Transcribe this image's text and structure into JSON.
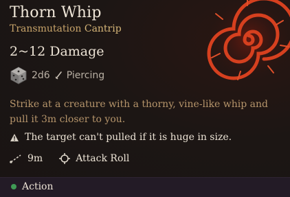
{
  "spell": {
    "name": "Thorn Whip",
    "school": "Transmutation",
    "level": "Cantrip",
    "damage": "2~12 Damage",
    "dice": "2d6",
    "damage_type": "Piercing",
    "description": "Strike at a creature with a thorny, vine-like whip and pull it 3m closer to you.",
    "warning": "The target can't pulled if it is huge in size.",
    "range": "9m",
    "roll": "Attack Roll",
    "cost": "Action"
  },
  "colors": {
    "school": "#c8a46a",
    "description": "#b6956b",
    "action_dot": "#3f9a55",
    "spiral": "#d23a1e"
  },
  "icons": {
    "spell_art": "thorn-spiral-icon",
    "dice": "d6-dice-icon",
    "damage_type": "dagger-icon",
    "warning": "warning-triangle-icon",
    "range": "range-line-icon",
    "roll": "crosshair-icon",
    "action": "action-dot-icon"
  }
}
